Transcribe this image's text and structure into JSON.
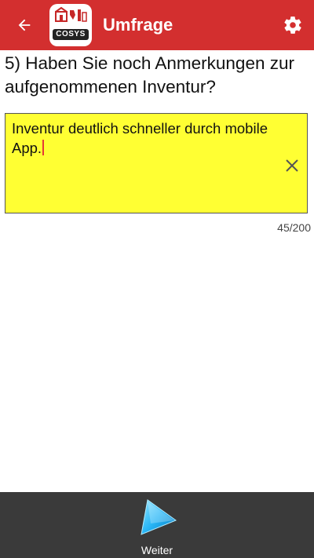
{
  "appbar": {
    "title": "Umfrage",
    "logo_text": "COSYS",
    "back_icon": "arrow-left-icon",
    "settings_icon": "gear-icon",
    "color": "#d32f2f"
  },
  "survey": {
    "question": "5) Haben Sie noch Anmerkungen zur aufgenommenen Inventur?",
    "answer_value": "Inventur deutlich schneller durch mobile App.",
    "answer_background": "#ffff33",
    "clear_icon": "close-icon",
    "char_counter": "45/200"
  },
  "footer": {
    "next_label": "Weiter",
    "next_icon": "play-arrow-icon"
  }
}
